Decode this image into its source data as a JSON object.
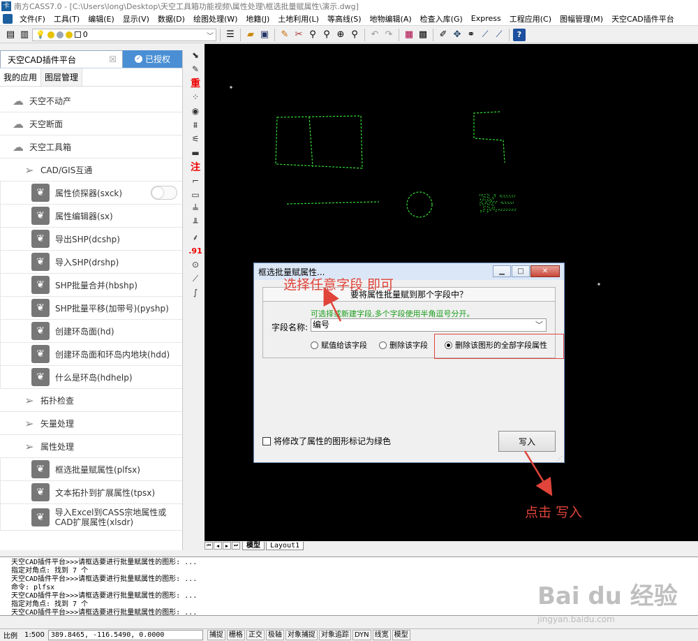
{
  "window": {
    "title": "南方CASS7.0 - [C:\\Users\\long\\Desktop\\天空工具箱功能视频\\属性处理\\框选批量赋属性\\演示.dwg]"
  },
  "menu": [
    "文件(F)",
    "工具(T)",
    "编辑(E)",
    "显示(V)",
    "数据(D)",
    "绘图处理(W)",
    "地籍(J)",
    "土地利用(L)",
    "等高线(S)",
    "地物编辑(A)",
    "检查入库(G)",
    "Express",
    "工程应用(C)",
    "图幅管理(M)",
    "天空CAD插件平台"
  ],
  "toolbar": {
    "layer_value": "0"
  },
  "panel": {
    "title": "天空CAD插件平台",
    "close": "☒",
    "auth": "已授权",
    "tabs": [
      "我的应用",
      "图层管理"
    ],
    "items": [
      {
        "label": "天空不动产",
        "level": 0
      },
      {
        "label": "天空断面",
        "level": 0
      },
      {
        "label": "天空工具箱",
        "level": 0
      },
      {
        "label": "CAD/GIS互通",
        "level": 1
      },
      {
        "label": "属性侦探器(sxck)",
        "level": 2
      },
      {
        "label": "属性编辑器(sx)",
        "level": 2
      },
      {
        "label": "导出SHP(dcshp)",
        "level": 2
      },
      {
        "label": "导入SHP(drshp)",
        "level": 2
      },
      {
        "label": "SHP批量合并(hbshp)",
        "level": 2
      },
      {
        "label": "SHP批量平移(加带号)(pyshp)",
        "level": 2
      },
      {
        "label": "创建环岛面(hd)",
        "level": 2
      },
      {
        "label": "创建环岛面和环岛内地块(hdd)",
        "level": 2
      },
      {
        "label": "什么是环岛(hdhelp)",
        "level": 2
      },
      {
        "label": "拓扑检查",
        "level": 1
      },
      {
        "label": "矢量处理",
        "level": 1
      },
      {
        "label": "属性处理",
        "level": 1
      },
      {
        "label": "框选批量赋属性(plfsx)",
        "level": 2
      },
      {
        "label": "文本拓扑到扩展属性(tpsx)",
        "level": 2
      },
      {
        "label": "导入Excel到CASS宗地属性或CAD扩展属性(xlsdr)",
        "level": 2
      }
    ]
  },
  "vtool": {
    "zhong": "重",
    "zhu": "注",
    "num": ".91"
  },
  "canvas": {
    "drawn_text": "张三"
  },
  "layout_tabs": [
    "模型",
    "Layout1"
  ],
  "dialog": {
    "title": "框选批量赋属性...",
    "group_title": "要将属性批量赋到那个字段中？",
    "hint": "可选择或新建字段,多个字段使用半角逗号分开。",
    "field_label": "字段名称:",
    "field_value": "编号",
    "radios": [
      "赋值给该字段",
      "删除该字段",
      "删除该图形的全部字段属性"
    ],
    "selected_radio": 2,
    "checkbox_label": "将修改了属性的图形标记为绿色",
    "ok_button": "写入"
  },
  "annotations": {
    "top": "选择任意字段  即可",
    "bottom": "点击  写入",
    "color": "#e0443a"
  },
  "command_lines": [
    "天空CAD插件平台>>>请框选要进行批量赋属性的图形: ...",
    "指定对角点: 找到 7 个",
    "天空CAD插件平台>>>请框选要进行批量赋属性的图形: ...",
    "命令: plfsx",
    "天空CAD插件平台>>>请框选要进行批量赋属性的图形: ...",
    "指定对角点: 找到 7 个",
    "天空CAD插件平台>>>请框选要进行批量赋属性的图形: ..."
  ],
  "status": {
    "scale_label": "比例",
    "scale": "1:500",
    "coords": "389.8465, -116.5490, 0.0000",
    "buttons": [
      "捕捉",
      "栅格",
      "正交",
      "极轴",
      "对象捕捉",
      "对象追踪",
      "DYN",
      "线宽",
      "模型"
    ]
  },
  "watermark": {
    "main": "Bai du 经验",
    "sub": "jingyan.baidu.com"
  }
}
